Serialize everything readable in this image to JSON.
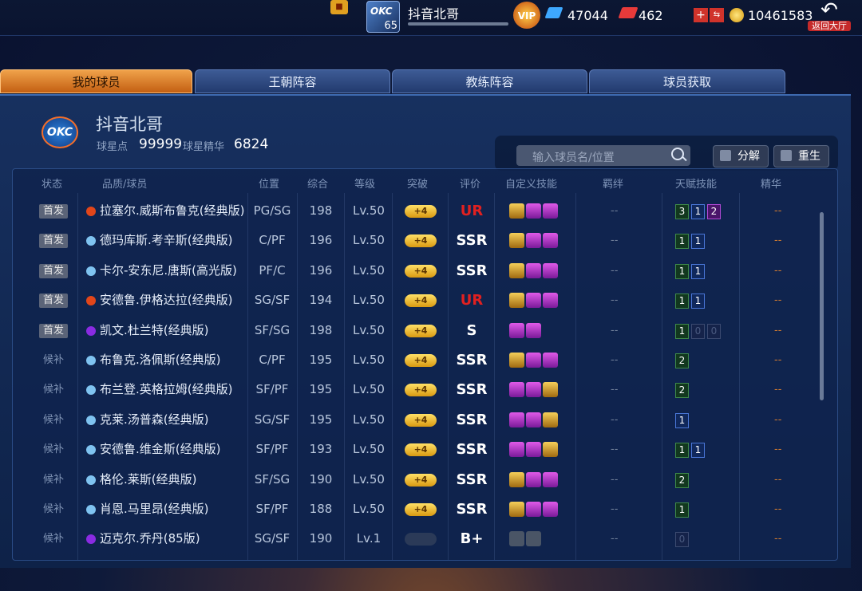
{
  "topbar": {
    "player_name": "抖音北哥",
    "level": "65",
    "diamonds": "47044",
    "tickets": "462",
    "coins": "10461583",
    "back_label": "返回大厅"
  },
  "tabs": [
    {
      "label": "我的球员",
      "active": true
    },
    {
      "label": "王朝阵容",
      "active": false
    },
    {
      "label": "教练阵容",
      "active": false
    },
    {
      "label": "球员获取",
      "active": false
    }
  ],
  "header": {
    "team_name": "抖音北哥",
    "star_points_label": "球星点",
    "star_points_value": "99999",
    "star_essence_label": "球星精华",
    "star_essence_value": "6824",
    "search_placeholder": "输入球员名/位置",
    "decompose_label": "分解",
    "rebirth_label": "重生"
  },
  "columns": [
    "状态",
    "品质/球员",
    "位置",
    "综合",
    "等级",
    "突破",
    "评价",
    "自定义技能",
    "羁绊",
    "天赋技能",
    "精华"
  ],
  "colors": {
    "orange_quality": "#e2461a",
    "blue_quality": "#7fc3f0",
    "purple_quality": "#8a2be2",
    "ur": "#e02020",
    "accent_tab": "#e48a2a"
  },
  "rows": [
    {
      "status": "首发",
      "starter": true,
      "quality": "orange",
      "name": "拉塞尔.威斯布鲁克(经典版)",
      "pos": "PG/SG",
      "ovr": "198",
      "lv": "Lv.50",
      "brk": "+4",
      "grade": "UR",
      "skills": [
        "gold",
        "purp",
        "purp"
      ],
      "bond": "--",
      "talents": [
        [
          "3",
          "green"
        ],
        [
          "1",
          "blue"
        ],
        [
          "2",
          "purp"
        ]
      ],
      "essence": "--"
    },
    {
      "status": "首发",
      "starter": true,
      "quality": "blue",
      "name": "德玛库斯.考辛斯(经典版)",
      "pos": "C/PF",
      "ovr": "196",
      "lv": "Lv.50",
      "brk": "+4",
      "grade": "SSR",
      "skills": [
        "gold",
        "purp",
        "purp"
      ],
      "bond": "--",
      "talents": [
        [
          "1",
          "green"
        ],
        [
          "1",
          "blue"
        ]
      ],
      "essence": "--"
    },
    {
      "status": "首发",
      "starter": true,
      "quality": "blue",
      "name": "卡尔-安东尼.唐斯(高光版)",
      "pos": "PF/C",
      "ovr": "196",
      "lv": "Lv.50",
      "brk": "+4",
      "grade": "SSR",
      "skills": [
        "gold",
        "purp",
        "purp"
      ],
      "bond": "--",
      "talents": [
        [
          "1",
          "green"
        ],
        [
          "1",
          "blue"
        ]
      ],
      "essence": "--"
    },
    {
      "status": "首发",
      "starter": true,
      "quality": "orange",
      "name": "安德鲁.伊格达拉(经典版)",
      "pos": "SG/SF",
      "ovr": "194",
      "lv": "Lv.50",
      "brk": "+4",
      "grade": "UR",
      "skills": [
        "gold",
        "purp",
        "purp"
      ],
      "bond": "--",
      "talents": [
        [
          "1",
          "green"
        ],
        [
          "1",
          "blue"
        ]
      ],
      "essence": "--"
    },
    {
      "status": "首发",
      "starter": true,
      "quality": "purple",
      "name": "凯文.杜兰特(经典版)",
      "pos": "SF/SG",
      "ovr": "198",
      "lv": "Lv.50",
      "brk": "+4",
      "grade": "S",
      "skills": [
        "purp",
        "purp"
      ],
      "bond": "--",
      "talents": [
        [
          "1",
          "green"
        ],
        [
          "0",
          "dim"
        ],
        [
          "0",
          "dim"
        ]
      ],
      "essence": "--"
    },
    {
      "status": "候补",
      "starter": false,
      "quality": "blue",
      "name": "布鲁克.洛佩斯(经典版)",
      "pos": "C/PF",
      "ovr": "195",
      "lv": "Lv.50",
      "brk": "+4",
      "grade": "SSR",
      "skills": [
        "gold",
        "purp",
        "purp"
      ],
      "bond": "--",
      "talents": [
        [
          "2",
          "green"
        ]
      ],
      "essence": "--"
    },
    {
      "status": "候补",
      "starter": false,
      "quality": "blue",
      "name": "布兰登.英格拉姆(经典版)",
      "pos": "SF/PF",
      "ovr": "195",
      "lv": "Lv.50",
      "brk": "+4",
      "grade": "SSR",
      "skills": [
        "purp",
        "purp",
        "gold"
      ],
      "bond": "--",
      "talents": [
        [
          "2",
          "green"
        ]
      ],
      "essence": "--"
    },
    {
      "status": "候补",
      "starter": false,
      "quality": "blue",
      "name": "克莱.汤普森(经典版)",
      "pos": "SG/SF",
      "ovr": "195",
      "lv": "Lv.50",
      "brk": "+4",
      "grade": "SSR",
      "skills": [
        "purp",
        "purp",
        "gold"
      ],
      "bond": "--",
      "talents": [
        [
          "1",
          "blue"
        ]
      ],
      "essence": "--"
    },
    {
      "status": "候补",
      "starter": false,
      "quality": "blue",
      "name": "安德鲁.维金斯(经典版)",
      "pos": "SF/PF",
      "ovr": "193",
      "lv": "Lv.50",
      "brk": "+4",
      "grade": "SSR",
      "skills": [
        "purp",
        "purp",
        "gold"
      ],
      "bond": "--",
      "talents": [
        [
          "1",
          "green"
        ],
        [
          "1",
          "blue"
        ]
      ],
      "essence": "--"
    },
    {
      "status": "候补",
      "starter": false,
      "quality": "blue",
      "name": "格伦.莱斯(经典版)",
      "pos": "SF/SG",
      "ovr": "190",
      "lv": "Lv.50",
      "brk": "+4",
      "grade": "SSR",
      "skills": [
        "gold",
        "purp",
        "purp"
      ],
      "bond": "--",
      "talents": [
        [
          "2",
          "green"
        ]
      ],
      "essence": "--"
    },
    {
      "status": "候补",
      "starter": false,
      "quality": "blue",
      "name": "肖恩.马里昂(经典版)",
      "pos": "SF/PF",
      "ovr": "188",
      "lv": "Lv.50",
      "brk": "+4",
      "grade": "SSR",
      "skills": [
        "gold",
        "purp",
        "purp"
      ],
      "bond": "--",
      "talents": [
        [
          "1",
          "green"
        ]
      ],
      "essence": "--"
    },
    {
      "status": "候补",
      "starter": false,
      "quality": "purple",
      "name": "迈克尔.乔丹(85版)",
      "pos": "SG/SF",
      "ovr": "190",
      "lv": "Lv.1",
      "brk": "",
      "grade": "B+",
      "skills": [
        "gray",
        "gray"
      ],
      "bond": "--",
      "talents": [
        [
          "0",
          "dim"
        ]
      ],
      "essence": "--"
    }
  ]
}
